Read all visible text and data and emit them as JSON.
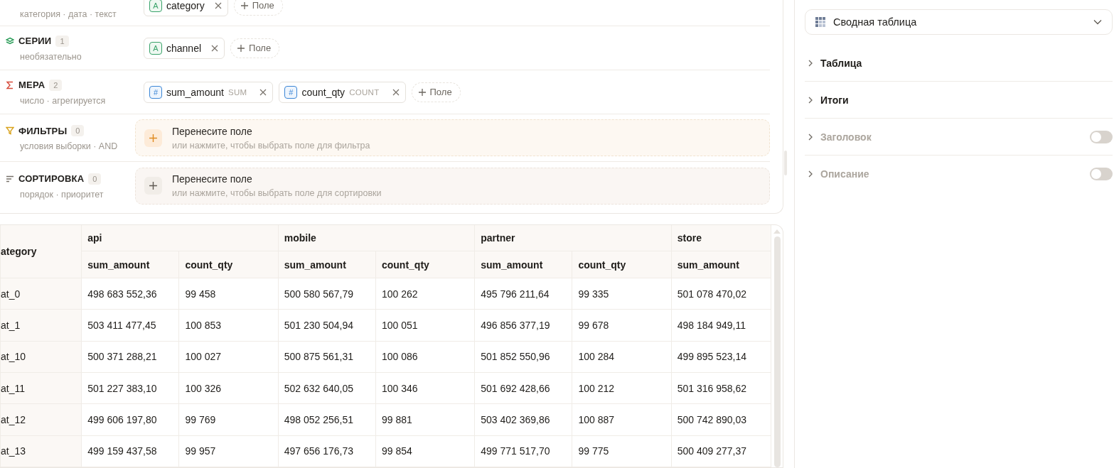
{
  "shelves": [
    {
      "hint": "категория · дата · текст",
      "chips": [
        {
          "kind": "text",
          "badge": "A",
          "name": "category"
        }
      ],
      "add_label": "Поле"
    },
    {
      "kind": "series",
      "title": "СЕРИИ",
      "count": "1",
      "hint": "необязательно",
      "chips": [
        {
          "kind": "text",
          "badge": "A",
          "name": "channel"
        }
      ],
      "add_label": "Поле"
    },
    {
      "kind": "measure",
      "title": "МЕРА",
      "count": "2",
      "hint": "число · агрегируется",
      "chips": [
        {
          "kind": "number",
          "badge": "#",
          "name": "sum_amount",
          "agg": "SUM"
        },
        {
          "kind": "number",
          "badge": "#",
          "name": "count_qty",
          "agg": "COUNT"
        }
      ],
      "add_label": "Поле"
    },
    {
      "kind": "filter",
      "title": "ФИЛЬТРЫ",
      "count": "0",
      "hint": "условия выборки · AND",
      "dropzone": {
        "title": "Перенесите поле",
        "hint": "или нажмите, чтобы выбрать поле для фильтра"
      }
    },
    {
      "kind": "sort",
      "title": "СОРТИРОВКА",
      "count": "0",
      "hint": "порядок · приоритет",
      "dropzone": {
        "title": "Перенесите поле",
        "hint": "или нажмите, чтобы выбрать поле для сортировки"
      }
    }
  ],
  "table": {
    "row_header": "ategory",
    "groups": [
      {
        "label": "api",
        "columns": [
          "sum_amount",
          "count_qty"
        ]
      },
      {
        "label": "mobile",
        "columns": [
          "sum_amount",
          "count_qty"
        ]
      },
      {
        "label": "partner",
        "columns": [
          "sum_amount",
          "count_qty"
        ]
      },
      {
        "label": "store",
        "columns": [
          "sum_amount"
        ]
      }
    ],
    "rows": [
      {
        "category": "at_0",
        "values": [
          "498 683 552,36",
          "99 458",
          "500 580 567,79",
          "100 262",
          "495 796 211,64",
          "99 335",
          "501 078 470,02"
        ]
      },
      {
        "category": "at_1",
        "values": [
          "503 411 477,45",
          "100 853",
          "501 230 504,94",
          "100 051",
          "496 856 377,19",
          "99 678",
          "498 184 949,11"
        ]
      },
      {
        "category": "at_10",
        "values": [
          "500 371 288,21",
          "100 027",
          "500 875 561,31",
          "100 086",
          "501 852 550,96",
          "100 284",
          "499 895 523,14"
        ]
      },
      {
        "category": "at_11",
        "values": [
          "501 227 383,10",
          "100 326",
          "502 632 640,05",
          "100 346",
          "501 692 428,66",
          "100 212",
          "501 316 958,62"
        ]
      },
      {
        "category": "at_12",
        "values": [
          "499 606 197,80",
          "99 769",
          "498 052 256,51",
          "99 881",
          "503 402 369,86",
          "100 887",
          "500 742 890,03"
        ]
      },
      {
        "category": "at_13",
        "values": [
          "499 159 437,58",
          "99 957",
          "497 656 176,73",
          "99 854",
          "499 771 517,70",
          "99 775",
          "500 409 277,37"
        ]
      }
    ]
  },
  "widget_type": {
    "value": "Сводная таблица"
  },
  "sections": [
    {
      "kind": "plain",
      "title": "Таблица",
      "expanded": false
    },
    {
      "kind": "plain",
      "title": "Итоги",
      "expanded": false
    },
    {
      "kind": "toggle",
      "title": "Заголовок",
      "expanded": false,
      "on": false
    },
    {
      "kind": "toggle",
      "title": "Описание",
      "expanded": false,
      "on": false
    }
  ]
}
